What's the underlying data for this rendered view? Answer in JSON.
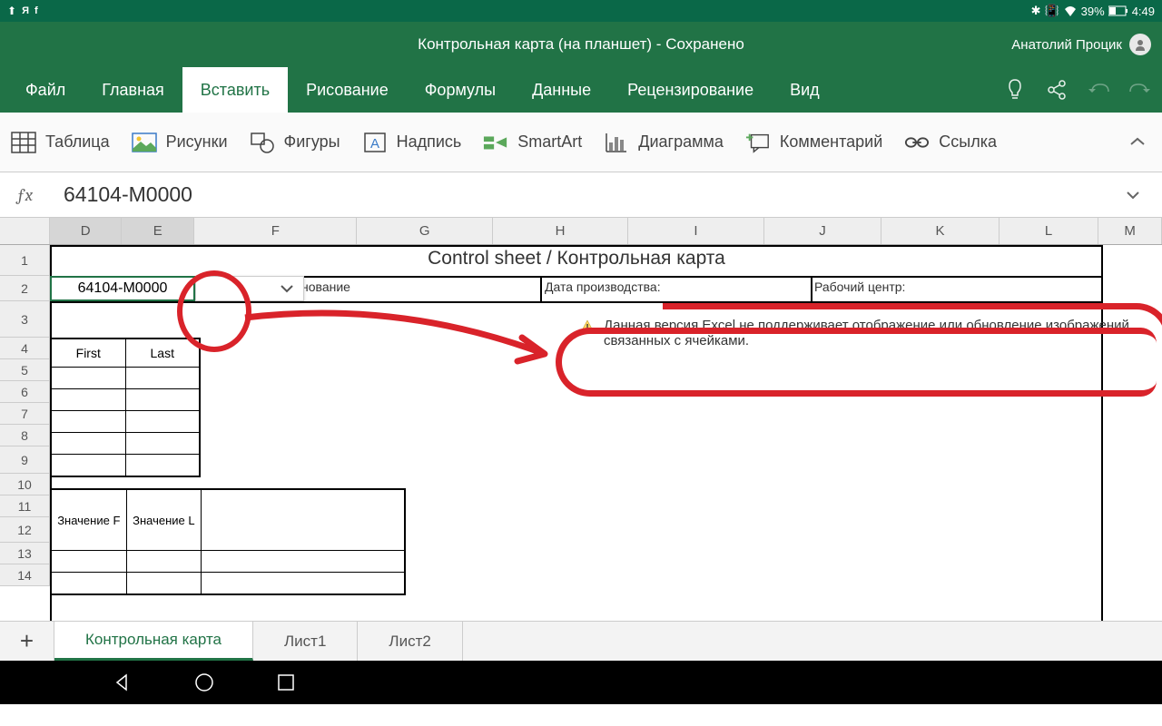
{
  "status": {
    "battery": "39%",
    "time": "4:49"
  },
  "title": {
    "doc": "Контрольная карта (на планшет)",
    "state": "Сохранено"
  },
  "user": {
    "name": "Анатолий Процик"
  },
  "tabs": {
    "file": "Файл",
    "home": "Главная",
    "insert": "Вставить",
    "draw": "Рисование",
    "formulas": "Формулы",
    "data": "Данные",
    "review": "Рецензирование",
    "view": "Вид"
  },
  "ribbon": {
    "table": "Таблица",
    "pictures": "Рисунки",
    "shapes": "Фигуры",
    "textbox": "Надпись",
    "smartart": "SmartArt",
    "chart": "Диаграмма",
    "comment": "Комментарий",
    "link": "Ссылка"
  },
  "formula": {
    "value": "64104-M0000"
  },
  "cols": {
    "D": "D",
    "E": "E",
    "F": "F",
    "G": "G",
    "H": "H",
    "I": "I",
    "J": "J",
    "K": "K",
    "L": "L",
    "M": "M"
  },
  "rows": {
    "r1": "1",
    "r2": "2",
    "r3": "3",
    "r4": "4",
    "r5": "5",
    "r6": "6",
    "r7": "7",
    "r8": "8",
    "r9": "9",
    "r10": "10",
    "r11": "11",
    "r12": "12",
    "r13": "13",
    "r14": "14"
  },
  "sheet": {
    "title": "Control sheet / Контрольная карта",
    "cell_value": "64104-M0000",
    "label_name": "/Наименование",
    "label_date": "Дата производства:",
    "label_workcenter": "Рабочий центр:",
    "tbl1": {
      "h1": "First",
      "h2": "Last"
    },
    "tbl2": {
      "h1": "Значение F",
      "h2": "Значение L"
    },
    "warning": "Данная версия Excel не поддерживает отображение или обновление изображений, связанных с ячейками."
  },
  "sheets": {
    "s1": "Контрольная карта",
    "s2": "Лист1",
    "s3": "Лист2"
  }
}
